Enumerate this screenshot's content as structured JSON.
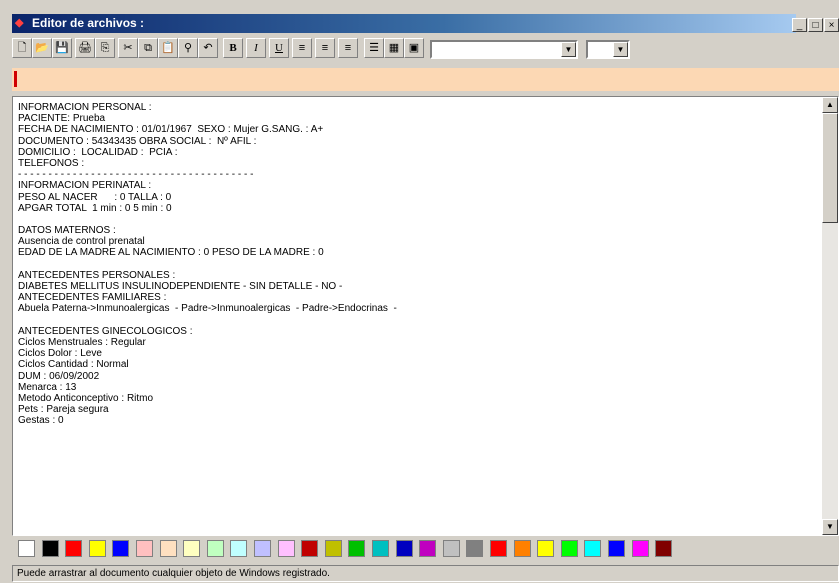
{
  "window": {
    "title": "Editor de archivos :",
    "icon": "app-icon",
    "controls": [
      "_",
      "□",
      "×"
    ]
  },
  "toolbar": {
    "buttons": [
      {
        "name": "new-doc-button",
        "icon": "new-document-icon",
        "glyph": "🗋"
      },
      {
        "name": "open-button",
        "icon": "open-folder-icon",
        "glyph": "📂"
      },
      {
        "name": "save-button",
        "icon": "floppy-icon",
        "glyph": "💾"
      },
      {
        "name": "print-button",
        "icon": "printer-icon",
        "glyph": "🖨"
      },
      {
        "name": "export-button",
        "icon": "export-icon",
        "glyph": "⎘"
      },
      {
        "name": "cut-button",
        "icon": "scissors-icon",
        "glyph": "✂"
      },
      {
        "name": "copy-button",
        "icon": "copy-icon",
        "glyph": "⧉"
      },
      {
        "name": "paste-button",
        "icon": "paste-icon",
        "glyph": "📋"
      },
      {
        "name": "find-button",
        "icon": "binoculars-icon",
        "glyph": "⚲"
      },
      {
        "name": "undo-button",
        "icon": "undo-icon",
        "glyph": "↶"
      },
      {
        "name": "bold-button",
        "icon": "bold-icon",
        "glyph": "B"
      },
      {
        "name": "italic-button",
        "icon": "italic-icon",
        "glyph": "I"
      },
      {
        "name": "underline-button",
        "icon": "underline-icon",
        "glyph": "U"
      },
      {
        "name": "align-left-button",
        "icon": "align-left-icon",
        "glyph": "≡"
      },
      {
        "name": "align-center-button",
        "icon": "align-center-icon",
        "glyph": "≡"
      },
      {
        "name": "align-right-button",
        "icon": "align-right-icon",
        "glyph": "≡"
      },
      {
        "name": "bullets-button",
        "icon": "bullet-list-icon",
        "glyph": "☰"
      },
      {
        "name": "format-button",
        "icon": "format-icon",
        "glyph": "▦"
      },
      {
        "name": "insert-button",
        "icon": "insert-icon",
        "glyph": "▣"
      }
    ],
    "font_combo_value": "",
    "size_combo_value": ""
  },
  "document": {
    "lines": [
      "INFORMACION PERSONAL :",
      "PACIENTE: Prueba",
      "FECHA DE NACIMIENTO : 01/01/1967  SEXO : Mujer G.SANG. : A+",
      "DOCUMENTO : 54343435 OBRA SOCIAL :  Nº AFIL :",
      "DOMICILIO :  LOCALIDAD :  PCIA :",
      "TELEFONOS :",
      "- - - - - - - - - - - - - - - - - - - - - - - - - - - - - - - - - - - - - - -",
      "INFORMACION PERINATAL :",
      "PESO AL NACER      : 0 TALLA : 0",
      "APGAR TOTAL  1 min : 0 5 min : 0",
      "",
      "DATOS MATERNOS :",
      "Ausencia de control prenatal",
      "EDAD DE LA MADRE AL NACIMIENTO : 0 PESO DE LA MADRE : 0",
      "",
      "ANTECEDENTES PERSONALES :",
      "DIABETES MELLITUS INSULINODEPENDIENTE - SIN DETALLE - NO -",
      "ANTECEDENTES FAMILIARES :",
      "Abuela Paterna->Inmunoalergicas  - Padre->Inmunoalergicas  - Padre->Endocrinas  -",
      "",
      "ANTECEDENTES GINECOLOGICOS :",
      "Ciclos Menstruales : Regular",
      "Ciclos Dolor : Leve",
      "Ciclos Cantidad : Normal",
      "DUM : 06/09/2002",
      "Menarca : 13",
      "Metodo Anticonceptivo : Ritmo",
      "Pets : Pareja segura",
      "Gestas : 0"
    ]
  },
  "palette": {
    "colors": [
      "#ffffff",
      "#000000",
      "#ff0000",
      "#ffff00",
      "#0000ff",
      "#ffc0c0",
      "#ffe0c0",
      "#ffffc0",
      "#c0ffc0",
      "#c0ffff",
      "#c0c0ff",
      "#ffc0ff",
      "#c00000",
      "#c0c000",
      "#00c000",
      "#00c0c0",
      "#0000c0",
      "#c000c0",
      "#c0c0c0",
      "#808080",
      "#ff0000",
      "#ff8000",
      "#ffff00",
      "#00ff00",
      "#00ffff",
      "#0000ff",
      "#ff00ff",
      "#800000"
    ]
  },
  "status": {
    "text": "Puede arrastrar al documento cualquier objeto de Windows registrado."
  }
}
